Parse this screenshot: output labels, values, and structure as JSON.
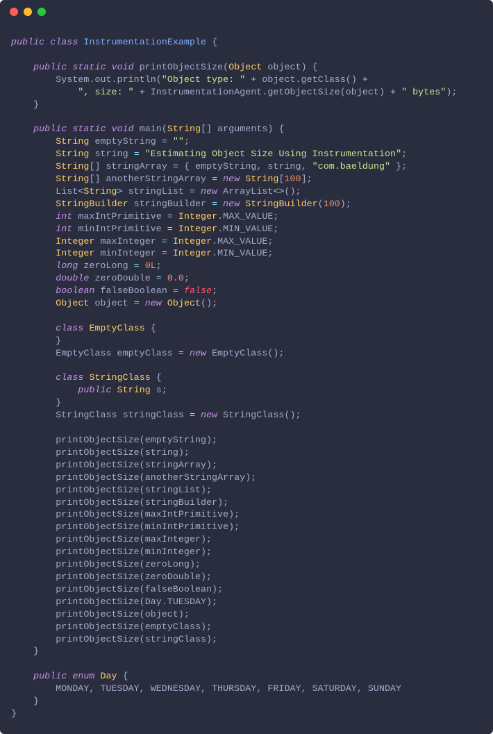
{
  "colors": {
    "background": "#292D3E",
    "default": "#A6ACCD",
    "keyword": "#C792EA",
    "type": "#FFCB6B",
    "classname": "#82AAFF",
    "string": "#C3E88D",
    "number": "#F78C6C",
    "operator": "#89DDFF",
    "boolean": "#FF5370",
    "dot_red": "#FF5F56",
    "dot_yellow": "#FFBD2E",
    "dot_green": "#27C93F"
  },
  "code": {
    "lines": [
      [
        [
          "kw",
          "public"
        ],
        [
          "id",
          " "
        ],
        [
          "kw",
          "class"
        ],
        [
          "id",
          " "
        ],
        [
          "cls",
          "InstrumentationExample"
        ],
        [
          "id",
          " {"
        ]
      ],
      [
        [
          "id",
          ""
        ]
      ],
      [
        [
          "id",
          "    "
        ],
        [
          "kw",
          "public"
        ],
        [
          "id",
          " "
        ],
        [
          "kw",
          "static"
        ],
        [
          "id",
          " "
        ],
        [
          "kw",
          "void"
        ],
        [
          "id",
          " printObjectSize("
        ],
        [
          "type",
          "Object"
        ],
        [
          "id",
          " object) {"
        ]
      ],
      [
        [
          "id",
          "        System.out.println("
        ],
        [
          "str",
          "\"Object type: \""
        ],
        [
          "id",
          " "
        ],
        [
          "op",
          "+"
        ],
        [
          "id",
          " object.getClass() "
        ],
        [
          "op",
          "+"
        ]
      ],
      [
        [
          "id",
          "            "
        ],
        [
          "str",
          "\", size: \""
        ],
        [
          "id",
          " "
        ],
        [
          "op",
          "+"
        ],
        [
          "id",
          " InstrumentationAgent.getObjectSize(object) "
        ],
        [
          "op",
          "+"
        ],
        [
          "id",
          " "
        ],
        [
          "str",
          "\" bytes\""
        ],
        [
          "id",
          ");"
        ]
      ],
      [
        [
          "id",
          "    }"
        ]
      ],
      [
        [
          "id",
          ""
        ]
      ],
      [
        [
          "id",
          "    "
        ],
        [
          "kw",
          "public"
        ],
        [
          "id",
          " "
        ],
        [
          "kw",
          "static"
        ],
        [
          "id",
          " "
        ],
        [
          "kw",
          "void"
        ],
        [
          "id",
          " main("
        ],
        [
          "type",
          "String"
        ],
        [
          "id",
          "[] arguments) {"
        ]
      ],
      [
        [
          "id",
          "        "
        ],
        [
          "type",
          "String"
        ],
        [
          "id",
          " emptyString "
        ],
        [
          "op",
          "="
        ],
        [
          "id",
          " "
        ],
        [
          "str",
          "\"\""
        ],
        [
          "id",
          ";"
        ]
      ],
      [
        [
          "id",
          "        "
        ],
        [
          "type",
          "String"
        ],
        [
          "id",
          " string "
        ],
        [
          "op",
          "="
        ],
        [
          "id",
          " "
        ],
        [
          "str",
          "\"Estimating Object Size Using Instrumentation\""
        ],
        [
          "id",
          ";"
        ]
      ],
      [
        [
          "id",
          "        "
        ],
        [
          "type",
          "String"
        ],
        [
          "id",
          "[] stringArray "
        ],
        [
          "op",
          "="
        ],
        [
          "id",
          " { emptyString, string, "
        ],
        [
          "str",
          "\"com.baeldung\""
        ],
        [
          "id",
          " };"
        ]
      ],
      [
        [
          "id",
          "        "
        ],
        [
          "type",
          "String"
        ],
        [
          "id",
          "[] anotherStringArray "
        ],
        [
          "op",
          "="
        ],
        [
          "id",
          " "
        ],
        [
          "kw",
          "new"
        ],
        [
          "id",
          " "
        ],
        [
          "type",
          "String"
        ],
        [
          "id",
          "["
        ],
        [
          "num",
          "100"
        ],
        [
          "id",
          "];"
        ]
      ],
      [
        [
          "id",
          "        List"
        ],
        [
          "op",
          "<"
        ],
        [
          "type",
          "String"
        ],
        [
          "op",
          ">"
        ],
        [
          "id",
          " stringList "
        ],
        [
          "op",
          "="
        ],
        [
          "id",
          " "
        ],
        [
          "kw",
          "new"
        ],
        [
          "id",
          " ArrayList"
        ],
        [
          "op",
          "<>"
        ],
        [
          "id",
          "();"
        ]
      ],
      [
        [
          "id",
          "        "
        ],
        [
          "type",
          "StringBuilder"
        ],
        [
          "id",
          " stringBuilder "
        ],
        [
          "op",
          "="
        ],
        [
          "id",
          " "
        ],
        [
          "kw",
          "new"
        ],
        [
          "id",
          " "
        ],
        [
          "type",
          "StringBuilder"
        ],
        [
          "id",
          "("
        ],
        [
          "num",
          "100"
        ],
        [
          "id",
          ");"
        ]
      ],
      [
        [
          "id",
          "        "
        ],
        [
          "kw",
          "int"
        ],
        [
          "id",
          " maxIntPrimitive "
        ],
        [
          "op",
          "="
        ],
        [
          "id",
          " "
        ],
        [
          "type",
          "Integer"
        ],
        [
          "id",
          ".MAX_VALUE;"
        ]
      ],
      [
        [
          "id",
          "        "
        ],
        [
          "kw",
          "int"
        ],
        [
          "id",
          " minIntPrimitive "
        ],
        [
          "op",
          "="
        ],
        [
          "id",
          " "
        ],
        [
          "type",
          "Integer"
        ],
        [
          "id",
          ".MIN_VALUE;"
        ]
      ],
      [
        [
          "id",
          "        "
        ],
        [
          "type",
          "Integer"
        ],
        [
          "id",
          " maxInteger "
        ],
        [
          "op",
          "="
        ],
        [
          "id",
          " "
        ],
        [
          "type",
          "Integer"
        ],
        [
          "id",
          ".MAX_VALUE;"
        ]
      ],
      [
        [
          "id",
          "        "
        ],
        [
          "type",
          "Integer"
        ],
        [
          "id",
          " minInteger "
        ],
        [
          "op",
          "="
        ],
        [
          "id",
          " "
        ],
        [
          "type",
          "Integer"
        ],
        [
          "id",
          ".MIN_VALUE;"
        ]
      ],
      [
        [
          "id",
          "        "
        ],
        [
          "kw",
          "long"
        ],
        [
          "id",
          " zeroLong "
        ],
        [
          "op",
          "="
        ],
        [
          "id",
          " "
        ],
        [
          "num",
          "0L"
        ],
        [
          "id",
          ";"
        ]
      ],
      [
        [
          "id",
          "        "
        ],
        [
          "kw",
          "double"
        ],
        [
          "id",
          " zeroDouble "
        ],
        [
          "op",
          "="
        ],
        [
          "id",
          " "
        ],
        [
          "num",
          "0.0"
        ],
        [
          "id",
          ";"
        ]
      ],
      [
        [
          "id",
          "        "
        ],
        [
          "kw",
          "boolean"
        ],
        [
          "id",
          " falseBoolean "
        ],
        [
          "op",
          "="
        ],
        [
          "id",
          " "
        ],
        [
          "bool",
          "false"
        ],
        [
          "id",
          ";"
        ]
      ],
      [
        [
          "id",
          "        "
        ],
        [
          "type",
          "Object"
        ],
        [
          "id",
          " object "
        ],
        [
          "op",
          "="
        ],
        [
          "id",
          " "
        ],
        [
          "kw",
          "new"
        ],
        [
          "id",
          " "
        ],
        [
          "type",
          "Object"
        ],
        [
          "id",
          "();"
        ]
      ],
      [
        [
          "id",
          ""
        ]
      ],
      [
        [
          "id",
          "        "
        ],
        [
          "kw",
          "class"
        ],
        [
          "id",
          " "
        ],
        [
          "type",
          "EmptyClass"
        ],
        [
          "id",
          " {"
        ]
      ],
      [
        [
          "id",
          "        }"
        ]
      ],
      [
        [
          "id",
          "        EmptyClass emptyClass "
        ],
        [
          "op",
          "="
        ],
        [
          "id",
          " "
        ],
        [
          "kw",
          "new"
        ],
        [
          "id",
          " EmptyClass();"
        ]
      ],
      [
        [
          "id",
          ""
        ]
      ],
      [
        [
          "id",
          "        "
        ],
        [
          "kw",
          "class"
        ],
        [
          "id",
          " "
        ],
        [
          "type",
          "StringClass"
        ],
        [
          "id",
          " {"
        ]
      ],
      [
        [
          "id",
          "            "
        ],
        [
          "kw",
          "public"
        ],
        [
          "id",
          " "
        ],
        [
          "type",
          "String"
        ],
        [
          "id",
          " s;"
        ]
      ],
      [
        [
          "id",
          "        }"
        ]
      ],
      [
        [
          "id",
          "        StringClass stringClass "
        ],
        [
          "op",
          "="
        ],
        [
          "id",
          " "
        ],
        [
          "kw",
          "new"
        ],
        [
          "id",
          " StringClass();"
        ]
      ],
      [
        [
          "id",
          ""
        ]
      ],
      [
        [
          "id",
          "        printObjectSize(emptyString);"
        ]
      ],
      [
        [
          "id",
          "        printObjectSize(string);"
        ]
      ],
      [
        [
          "id",
          "        printObjectSize(stringArray);"
        ]
      ],
      [
        [
          "id",
          "        printObjectSize(anotherStringArray);"
        ]
      ],
      [
        [
          "id",
          "        printObjectSize(stringList);"
        ]
      ],
      [
        [
          "id",
          "        printObjectSize(stringBuilder);"
        ]
      ],
      [
        [
          "id",
          "        printObjectSize(maxIntPrimitive);"
        ]
      ],
      [
        [
          "id",
          "        printObjectSize(minIntPrimitive);"
        ]
      ],
      [
        [
          "id",
          "        printObjectSize(maxInteger);"
        ]
      ],
      [
        [
          "id",
          "        printObjectSize(minInteger);"
        ]
      ],
      [
        [
          "id",
          "        printObjectSize(zeroLong);"
        ]
      ],
      [
        [
          "id",
          "        printObjectSize(zeroDouble);"
        ]
      ],
      [
        [
          "id",
          "        printObjectSize(falseBoolean);"
        ]
      ],
      [
        [
          "id",
          "        printObjectSize(Day.TUESDAY);"
        ]
      ],
      [
        [
          "id",
          "        printObjectSize(object);"
        ]
      ],
      [
        [
          "id",
          "        printObjectSize(emptyClass);"
        ]
      ],
      [
        [
          "id",
          "        printObjectSize(stringClass);"
        ]
      ],
      [
        [
          "id",
          "    }"
        ]
      ],
      [
        [
          "id",
          ""
        ]
      ],
      [
        [
          "id",
          "    "
        ],
        [
          "kw",
          "public"
        ],
        [
          "id",
          " "
        ],
        [
          "kw",
          "enum"
        ],
        [
          "id",
          " "
        ],
        [
          "type",
          "Day"
        ],
        [
          "id",
          " {"
        ]
      ],
      [
        [
          "id",
          "        MONDAY, TUESDAY, WEDNESDAY, THURSDAY, FRIDAY, SATURDAY, SUNDAY"
        ]
      ],
      [
        [
          "id",
          "    }"
        ]
      ],
      [
        [
          "id",
          "}"
        ]
      ]
    ]
  }
}
